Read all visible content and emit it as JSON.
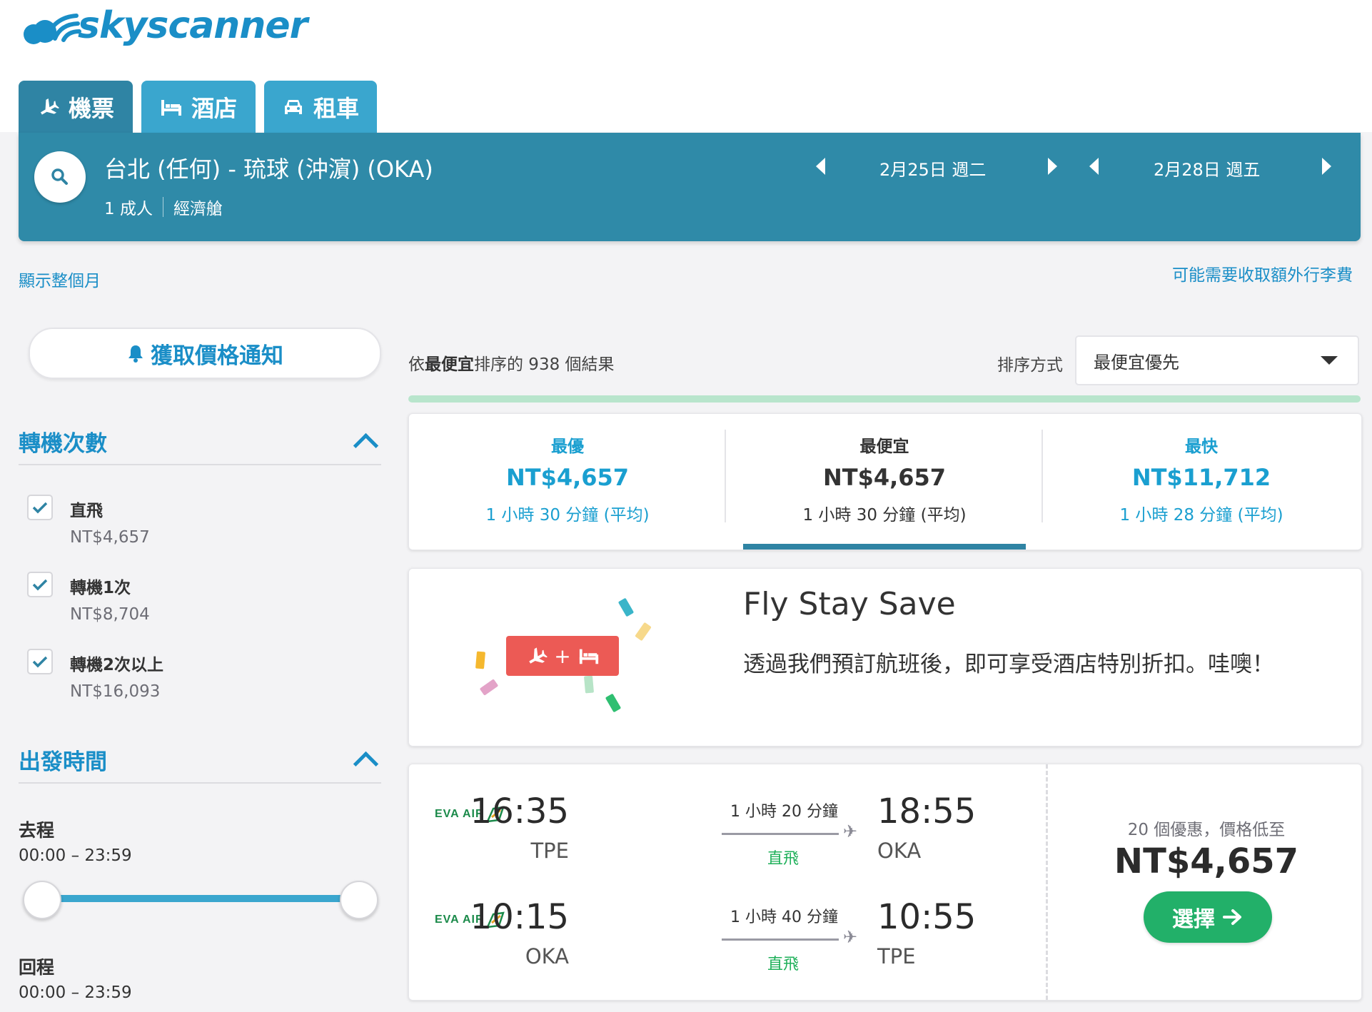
{
  "brand": {
    "name": "skyscanner",
    "color": "#1a8ec7"
  },
  "tabs": [
    {
      "label": "機票",
      "icon": "plane-icon",
      "active": true
    },
    {
      "label": "酒店",
      "icon": "bed-icon",
      "active": false
    },
    {
      "label": "租車",
      "icon": "car-icon",
      "active": false
    }
  ],
  "search": {
    "route": "台北 (任何) - 琉球 (沖濵) (OKA)",
    "passengers": "1 成人",
    "cabin": "經濟艙",
    "depart_date": "2月25日 週二",
    "return_date": "2月28日 週五"
  },
  "links": {
    "show_month": "顯示整個月",
    "baggage_fee": "可能需要收取額外行李費"
  },
  "sidebar": {
    "price_alert": "獲取價格通知",
    "stops": {
      "title": "轉機次數",
      "options": [
        {
          "label": "直飛",
          "price": "NT$4,657",
          "checked": true
        },
        {
          "label": "轉機1次",
          "price": "NT$8,704",
          "checked": true
        },
        {
          "label": "轉機2次以上",
          "price": "NT$16,093",
          "checked": true
        }
      ]
    },
    "depart_time": {
      "title": "出發時間",
      "outbound_label": "去程",
      "outbound_range": "00:00 – 23:59",
      "return_label": "回程",
      "return_range": "00:00 – 23:59"
    }
  },
  "results": {
    "count_prefix": "依",
    "count_sort": "最便宜",
    "count_suffix": "排序的 938 個結果",
    "sort_label": "排序方式",
    "sort_value": "最便宜優先",
    "summary": [
      {
        "title": "最優",
        "price": "NT$4,657",
        "duration": "1 小時 30 分鐘 (平均)",
        "color": "#1a9fd0"
      },
      {
        "title": "最便宜",
        "price": "NT$4,657",
        "duration": "1 小時 30 分鐘 (平均)",
        "color": "#333333",
        "active": true
      },
      {
        "title": "最快",
        "price": "NT$11,712",
        "duration": "1 小時 28 分鐘 (平均)",
        "color": "#1a9fd0"
      }
    ]
  },
  "promo": {
    "title": "Fly Stay Save",
    "text": "透過我們預訂航班後，即可享受酒店特別折扣。哇噢！",
    "badge_plus": "+"
  },
  "flight": {
    "airline": "EVA AIR",
    "outbound": {
      "depart_time": "16:35",
      "depart_code": "TPE",
      "duration": "1 小時 20 分鐘",
      "stops": "直飛",
      "arrive_time": "18:55",
      "arrive_code": "OKA"
    },
    "inbound": {
      "depart_time": "10:15",
      "depart_code": "OKA",
      "duration": "1 小時 40 分鐘",
      "stops": "直飛",
      "arrive_time": "10:55",
      "arrive_code": "TPE"
    },
    "deals": "20 個優惠，價格低至",
    "price": "NT$4,657",
    "select_label": "選擇"
  }
}
